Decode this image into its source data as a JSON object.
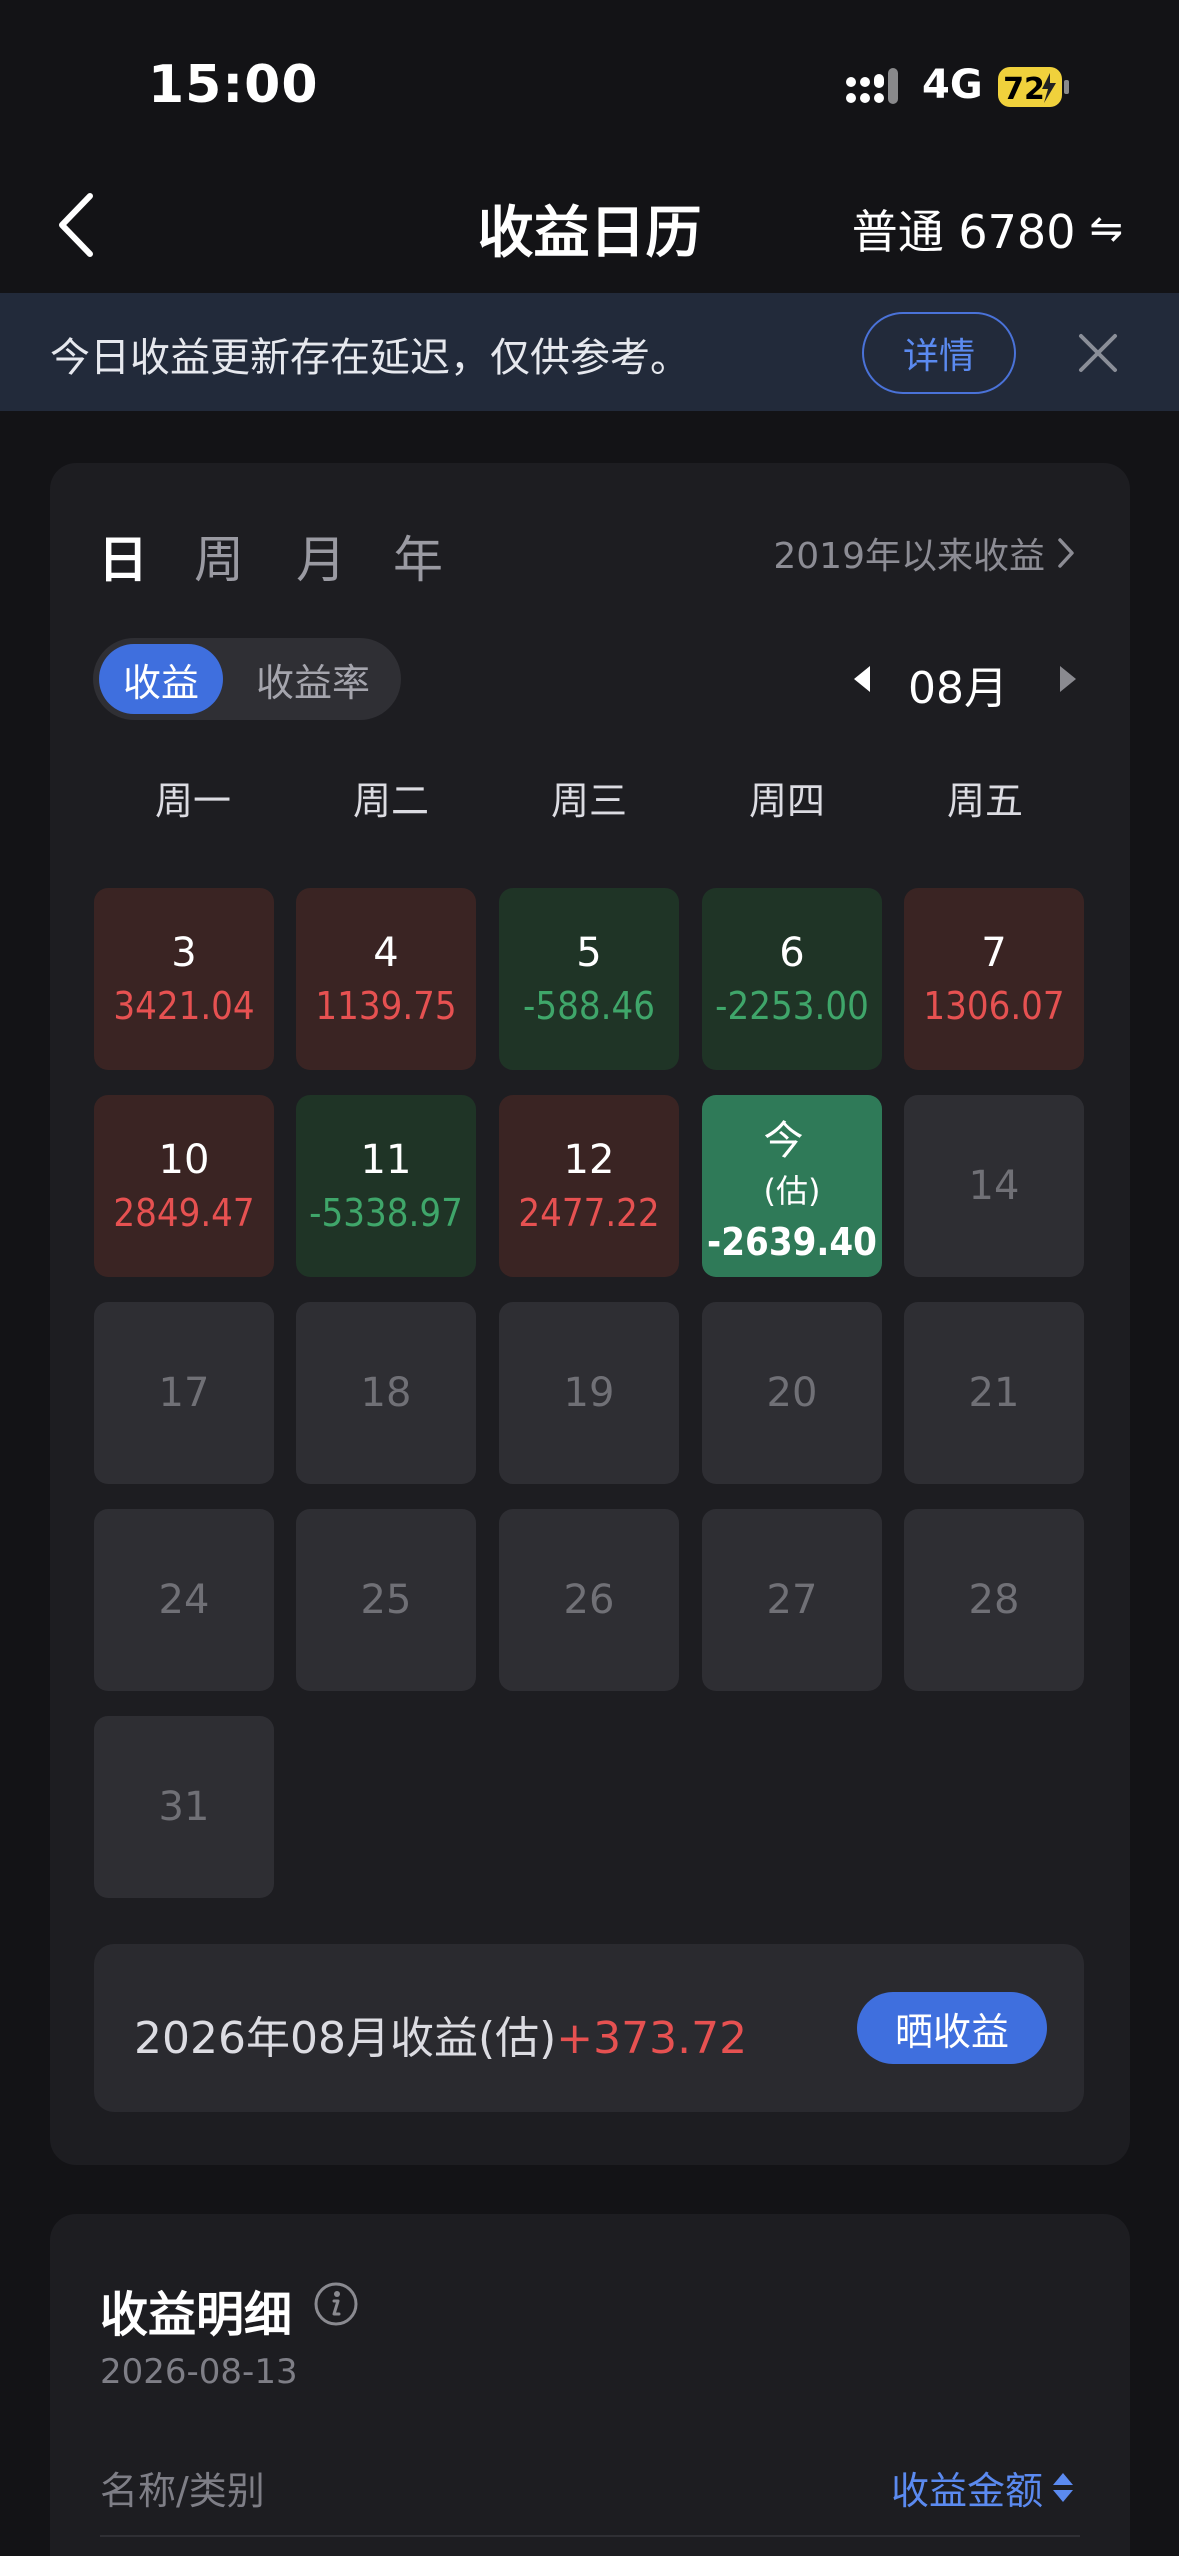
{
  "status_bar": {
    "time": "15:00",
    "network": "4G",
    "battery": "72"
  },
  "nav": {
    "title": "收益日历",
    "account": "普通 6780",
    "swap_icon": "⇋"
  },
  "notice": {
    "text": "今日收益更新存在延迟，仅供参考。",
    "detail_label": "详情"
  },
  "period_tabs": [
    "日",
    "周",
    "月",
    "年"
  ],
  "active_period": "日",
  "since_label": "2019年以来收益",
  "toggle": {
    "options": [
      "收益",
      "收益率"
    ],
    "active": "收益"
  },
  "month": "08月",
  "weekdays": [
    "周一",
    "周二",
    "周三",
    "周四",
    "周五"
  ],
  "days": [
    {
      "num": "3",
      "value": "3421.04",
      "type": "pos"
    },
    {
      "num": "4",
      "value": "1139.75",
      "type": "pos"
    },
    {
      "num": "5",
      "value": "-588.46",
      "type": "neg"
    },
    {
      "num": "6",
      "value": "-2253.00",
      "type": "neg"
    },
    {
      "num": "7",
      "value": "1306.07",
      "type": "pos"
    },
    {
      "num": "10",
      "value": "2849.47",
      "type": "pos"
    },
    {
      "num": "11",
      "value": "-5338.97",
      "type": "neg"
    },
    {
      "num": "12",
      "value": "2477.22",
      "type": "pos"
    },
    {
      "num": "今",
      "sub": "(估)",
      "value": "-2639.40",
      "type": "today"
    },
    {
      "num": "14",
      "value": "",
      "type": "empty"
    },
    {
      "num": "17",
      "value": "",
      "type": "empty"
    },
    {
      "num": "18",
      "value": "",
      "type": "empty"
    },
    {
      "num": "19",
      "value": "",
      "type": "empty"
    },
    {
      "num": "20",
      "value": "",
      "type": "empty"
    },
    {
      "num": "21",
      "value": "",
      "type": "empty"
    },
    {
      "num": "24",
      "value": "",
      "type": "empty"
    },
    {
      "num": "25",
      "value": "",
      "type": "empty"
    },
    {
      "num": "26",
      "value": "",
      "type": "empty"
    },
    {
      "num": "27",
      "value": "",
      "type": "empty"
    },
    {
      "num": "28",
      "value": "",
      "type": "empty"
    },
    {
      "num": "31",
      "value": "",
      "type": "empty"
    }
  ],
  "summary": {
    "label": "2026年08月收益(估)",
    "value": "+373.72",
    "share_label": "晒收益"
  },
  "detail": {
    "title": "收益明细",
    "date": "2026-08-13",
    "col_name": "名称/类别",
    "col_amount": "收益金额"
  },
  "colors": {
    "profit": "#e65151",
    "loss": "#3fa66a",
    "accent": "#3f6fde"
  }
}
